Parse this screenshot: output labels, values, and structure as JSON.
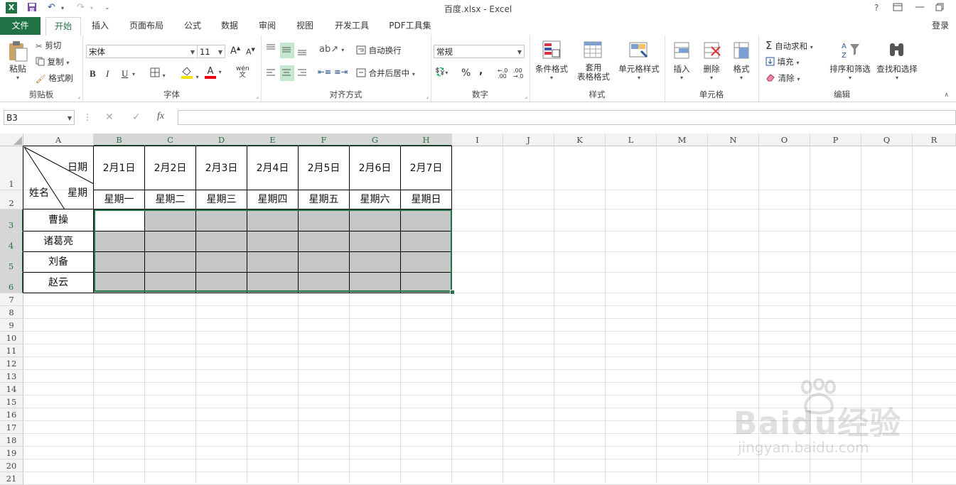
{
  "window": {
    "title": "百度.xlsx - Excel",
    "help": "?",
    "signin": "登录"
  },
  "tabs": [
    "文件",
    "开始",
    "插入",
    "页面布局",
    "公式",
    "数据",
    "审阅",
    "视图",
    "开发工具",
    "PDF工具集"
  ],
  "clipboard": {
    "paste": "粘贴",
    "cut": "剪切",
    "copy": "复制",
    "format_painter": "格式刷",
    "label": "剪贴板"
  },
  "font": {
    "name": "宋体",
    "size": "11",
    "bold": "B",
    "italic": "I",
    "underline": "U",
    "phonetic": "wén",
    "label": "字体"
  },
  "alignment": {
    "wrap": "自动换行",
    "merge": "合并后居中",
    "label": "对齐方式"
  },
  "number": {
    "format": "常规",
    "percent": "%",
    "comma": ",",
    "label": "数字"
  },
  "styles": {
    "conditional": "条件格式",
    "table_line1": "套用",
    "table_line2": "表格格式",
    "cell_styles": "单元格样式",
    "label": "样式"
  },
  "cells": {
    "insert": "插入",
    "delete": "删除",
    "format": "格式",
    "label": "单元格"
  },
  "editing": {
    "autosum": "自动求和",
    "fill": "填充",
    "clear": "清除",
    "sort": "排序和筛选",
    "find": "查找和选择",
    "label": "编辑"
  },
  "formula_bar": {
    "name_box": "B3",
    "fx": "fx",
    "content": ""
  },
  "columns": [
    "A",
    "B",
    "C",
    "D",
    "E",
    "F",
    "G",
    "H",
    "I",
    "J",
    "K",
    "L",
    "M",
    "N",
    "O",
    "P",
    "Q",
    "R"
  ],
  "rows": [
    "1",
    "2",
    "3",
    "4",
    "5",
    "6",
    "7",
    "8",
    "9",
    "10",
    "11",
    "12",
    "13",
    "14",
    "15",
    "16",
    "17",
    "18",
    "19",
    "20",
    "21"
  ],
  "table": {
    "corner": {
      "date": "日期",
      "weekday": "星期",
      "name": "姓名"
    },
    "dates": [
      "2月1日",
      "2月2日",
      "2月3日",
      "2月4日",
      "2月5日",
      "2月6日",
      "2月7日"
    ],
    "weekdays": [
      "星期一",
      "星期二",
      "星期三",
      "星期四",
      "星期五",
      "星期六",
      "星期日"
    ],
    "names": [
      "曹操",
      "诸葛亮",
      "刘备",
      "赵云"
    ]
  },
  "watermark": {
    "brand": "Baidu经验",
    "url": "jingyan.baidu.com"
  },
  "colors": {
    "excel_green": "#217346",
    "selection_shade": "#c6c6c6"
  }
}
